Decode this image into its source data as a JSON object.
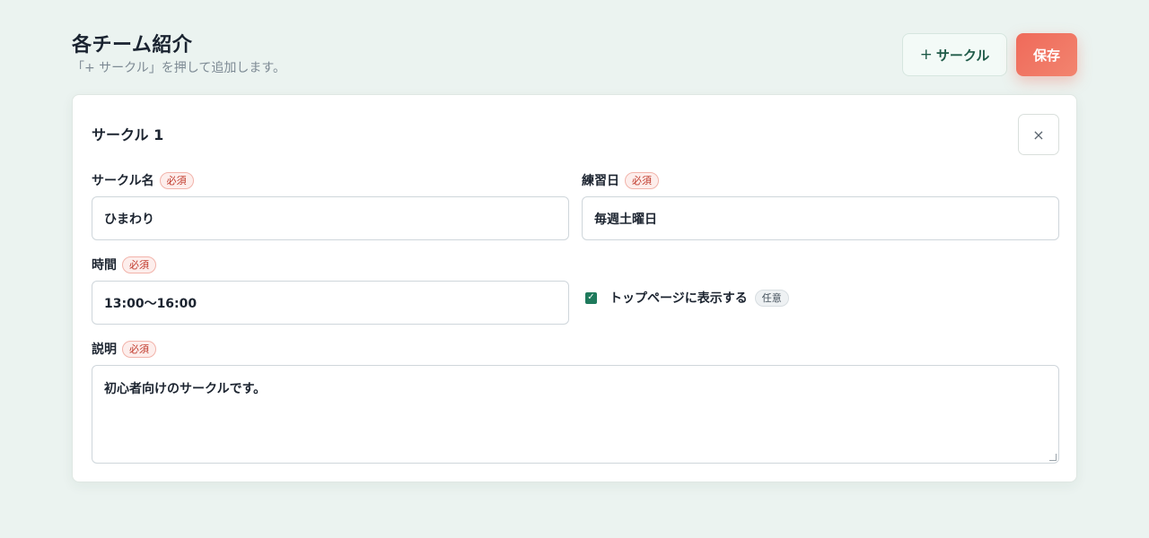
{
  "header": {
    "title": "各チーム紹介",
    "subtitle": "「+ サークル」を押して追加します。",
    "add_button": {
      "plus": "+",
      "label": "サークル"
    },
    "save_button": "保存"
  },
  "card": {
    "title": "サークル 1",
    "close_symbol": "×",
    "fields": {
      "name": {
        "label": "サークル名",
        "badge": "必須",
        "value": "ひまわり"
      },
      "practice_day": {
        "label": "練習日",
        "badge": "必須",
        "value": "毎週土曜日"
      },
      "time": {
        "label": "時間",
        "badge": "必須",
        "value": "13:00〜16:00"
      },
      "show_on_top": {
        "label": "トップページに表示する",
        "badge": "任意",
        "checked": true
      },
      "description": {
        "label": "説明",
        "badge": "必須",
        "value": "初心者向けのサークルです。"
      }
    }
  },
  "colors": {
    "background": "#ebf3f0",
    "accent": "#ef6a5a",
    "checkbox": "#1f7a5c",
    "required_badge": "#c0392b"
  }
}
